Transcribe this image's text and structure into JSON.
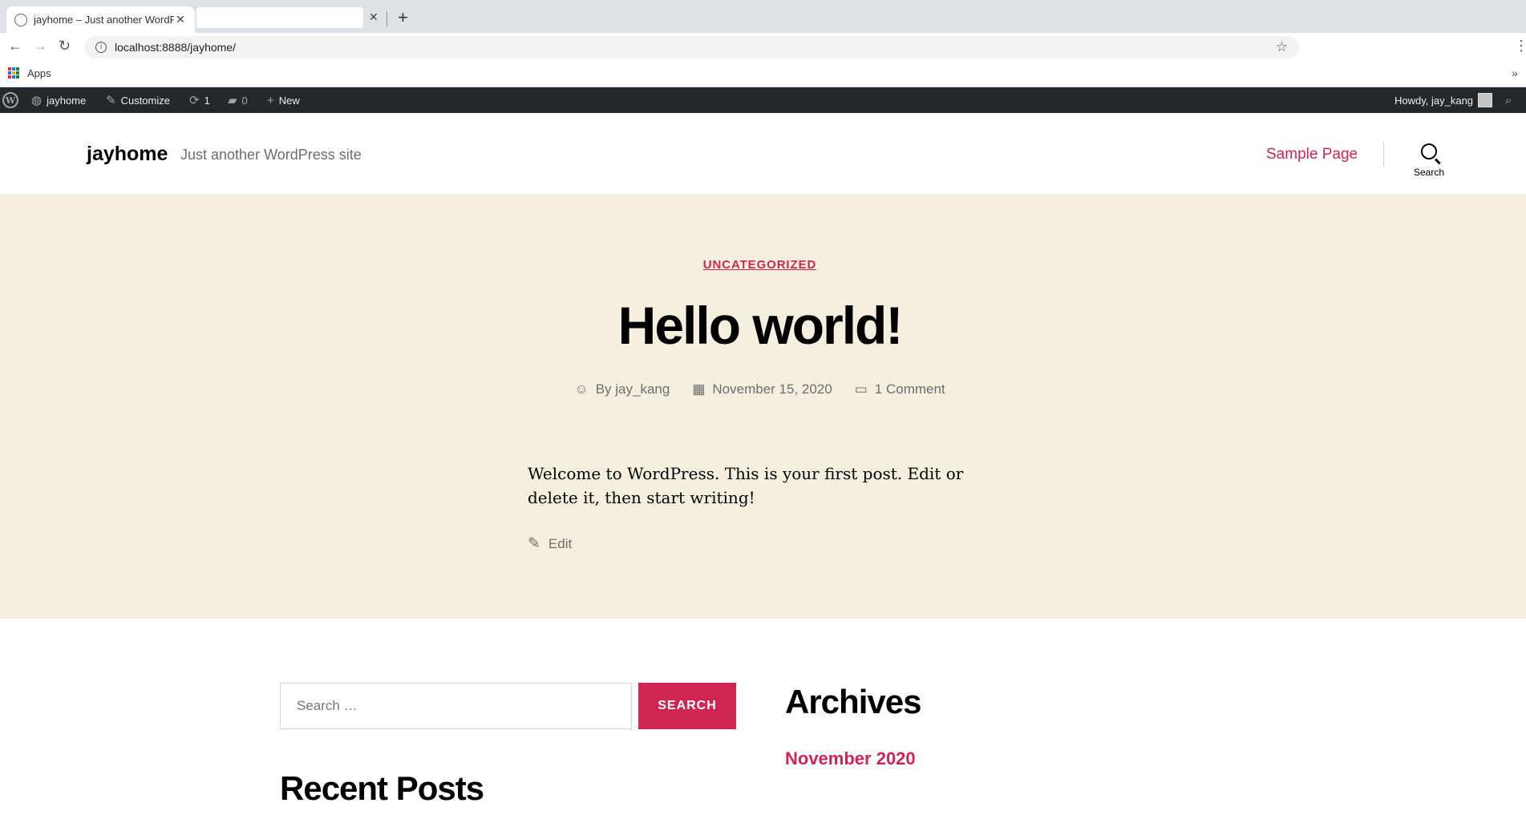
{
  "browser": {
    "active_tab_title": "jayhome – Just another WordPress site",
    "url": "localhost:8888/jayhome/",
    "bookmark_apps": "Apps"
  },
  "admin_bar": {
    "site_name": "jayhome",
    "customize": "Customize",
    "updates_count": "1",
    "comments_count": "0",
    "new": "New",
    "howdy": "Howdy, jay_kang"
  },
  "header": {
    "site_title": "jayhome",
    "site_description": "Just another WordPress site",
    "nav_link": "Sample Page",
    "search_label": "Search"
  },
  "post": {
    "category": "UNCATEGORIZED",
    "title": "Hello world!",
    "author": "By jay_kang",
    "date": "November 15, 2020",
    "comments": "1 Comment",
    "excerpt": "Welcome to WordPress. This is your first post. Edit or delete it, then start writing!",
    "edit": "Edit"
  },
  "widgets": {
    "search_placeholder": "Search …",
    "search_button": "SEARCH",
    "recent_posts_heading": "Recent Posts",
    "archives_heading": "Archives",
    "archive_month": "November 2020"
  },
  "colors": {
    "accent": "#cd2653",
    "hero_bg": "#f5efe0",
    "admin_bar_bg": "#23282d"
  }
}
